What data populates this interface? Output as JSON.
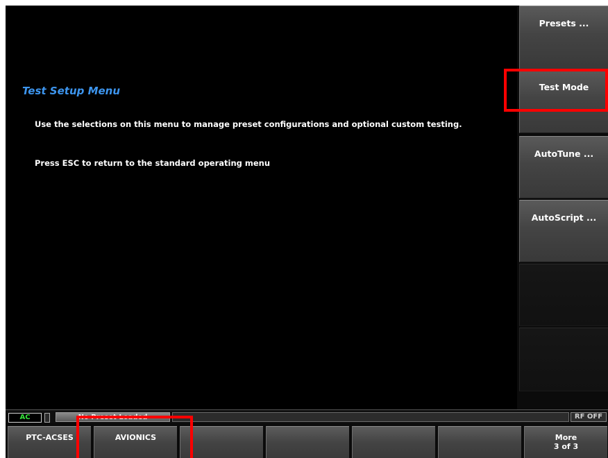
{
  "main": {
    "title": "Test Setup Menu",
    "description": "Use the selections on this menu to manage preset configurations and optional custom testing.",
    "hint": "Press ESC to return to the standard operating menu"
  },
  "right_softkeys": [
    {
      "label": "Presets ..."
    },
    {
      "label": "Test Mode"
    },
    {
      "label": "AutoTune ..."
    },
    {
      "label": "AutoScript ..."
    },
    {
      "label": ""
    },
    {
      "label": ""
    }
  ],
  "status": {
    "power": "AC",
    "power_color": "#35e23a",
    "preset": "No Preset Loaded",
    "rf_state": "RF OFF"
  },
  "bottom_softkeys": [
    {
      "label": "PTC-ACSES"
    },
    {
      "label": "AVIONICS"
    },
    {
      "label": ""
    },
    {
      "label": ""
    },
    {
      "label": ""
    },
    {
      "label": ""
    },
    {
      "label": "More\n3 of 3"
    }
  ],
  "colors": {
    "title": "#3d95ee",
    "highlight": "#ff0000"
  }
}
